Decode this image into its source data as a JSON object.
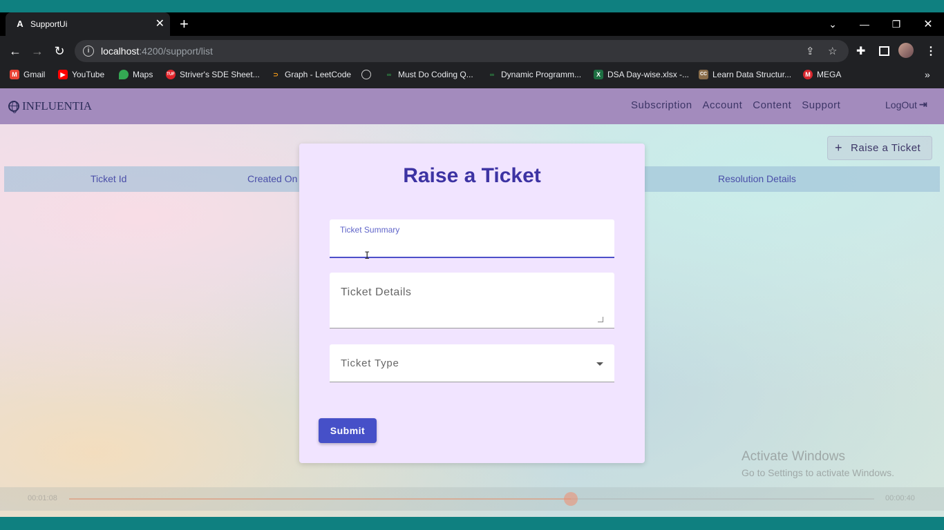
{
  "browser": {
    "tab_title": "SupportUi",
    "tab_icon": "angular-icon",
    "url_host": "localhost",
    "url_path": ":4200/support/list",
    "bookmarks": [
      {
        "label": "Gmail",
        "icon": "gmail-icon"
      },
      {
        "label": "YouTube",
        "icon": "youtube-icon"
      },
      {
        "label": "Maps",
        "icon": "maps-icon"
      },
      {
        "label": "Striver's SDE Sheet...",
        "icon": "tuf-icon"
      },
      {
        "label": "Graph - LeetCode",
        "icon": "leetcode-icon"
      },
      {
        "label": "",
        "icon": "globe-icon"
      },
      {
        "label": "Must Do Coding Q...",
        "icon": "gfg-icon"
      },
      {
        "label": "Dynamic Programm...",
        "icon": "gfg-icon"
      },
      {
        "label": "DSA Day-wise.xlsx -...",
        "icon": "excel-icon"
      },
      {
        "label": "Learn Data Structur...",
        "icon": "cc-icon"
      },
      {
        "label": "MEGA",
        "icon": "mega-icon"
      }
    ],
    "more_bookmarks": "»"
  },
  "app": {
    "brand": "INFLUENTIA",
    "nav": [
      "Subscription",
      "Account",
      "Content",
      "Support"
    ],
    "logout": "LogOut",
    "raise_button": "Raise a Ticket",
    "table_headers": {
      "col1": "Ticket Id",
      "col2": "Created On",
      "col3": "Resolution Details"
    }
  },
  "modal": {
    "title": "Raise a Ticket",
    "summary_label": "Ticket Summary",
    "details_placeholder": "Ticket Details",
    "type_placeholder": "Ticket Type",
    "submit_label": "Submit"
  },
  "video": {
    "current_time": "00:01:08",
    "duration": "00:00:40",
    "progress": 0.62
  },
  "watermark": {
    "line1": "Activate Windows",
    "line2": "Go to Settings to activate Windows."
  },
  "colors": {
    "nav_bg": "#a38bbd",
    "modal_bg": "#f1e4ff",
    "accent": "#4650c8",
    "title": "#3d33a3"
  }
}
